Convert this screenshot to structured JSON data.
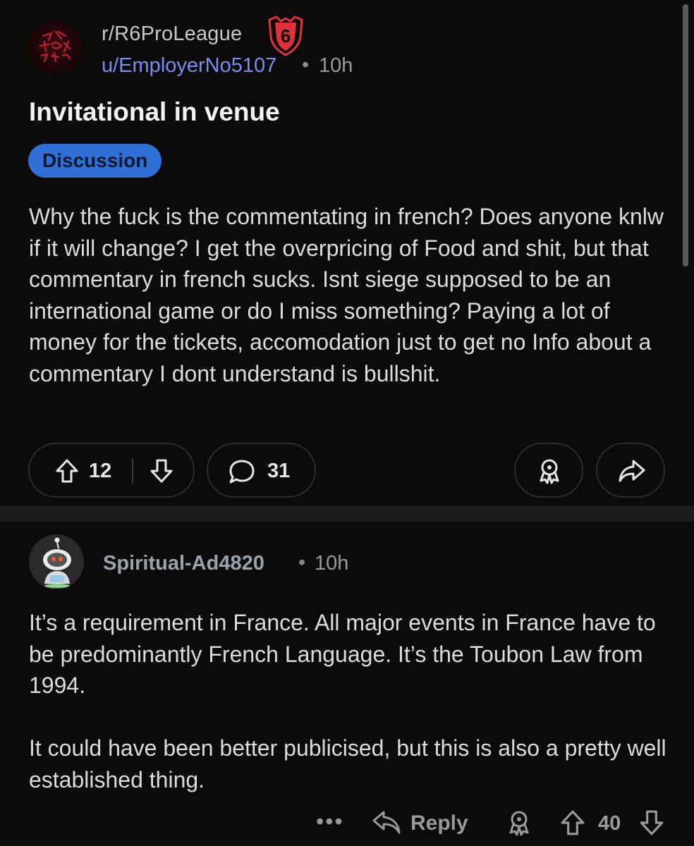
{
  "post": {
    "subreddit": "r/R6ProLeague",
    "author": "u/EmployerNo5107",
    "separator": "•",
    "time": "10h",
    "title": "Invitational in venue",
    "flair": "Discussion",
    "body": "Why the fuck is the commentating in french? Does anyone knlw if it will change? I get the overpricing of Food and shit, but that commentary in french sucks. Isnt siege supposed to be an international game or do I miss something? Paying a lot of money for the tickets, accomodation just to get no Info about a commentary I dont understand is bullshit.",
    "upvotes": "12",
    "comments": "31",
    "icons": {
      "upvote": "arrow-up-icon",
      "downvote": "arrow-down-icon",
      "comment": "speech-bubble-icon",
      "award": "award-icon",
      "share": "share-arrow-icon",
      "sub_badge": "six-invitational-badge-icon"
    }
  },
  "comment": {
    "author": "Spiritual-Ad4820",
    "separator": "•",
    "time": "10h",
    "paragraphs": [
      "It’s a requirement in France. All major events in France have to be predominantly French Language. It’s the Toubon Law from 1994.",
      "It could have been better publicised, but this is also a pretty well established thing."
    ],
    "more": "•••",
    "reply_label": "Reply",
    "score": "40",
    "icons": {
      "reply": "reply-arrow-icon",
      "award": "award-icon",
      "upvote": "arrow-up-icon",
      "downvote": "arrow-down-icon",
      "more": "more-options-icon"
    }
  },
  "colors": {
    "background": "#0b0b0b",
    "flair_bg": "#2f6fd6",
    "username": "#7b8ef0",
    "badge": "#e0323b"
  }
}
